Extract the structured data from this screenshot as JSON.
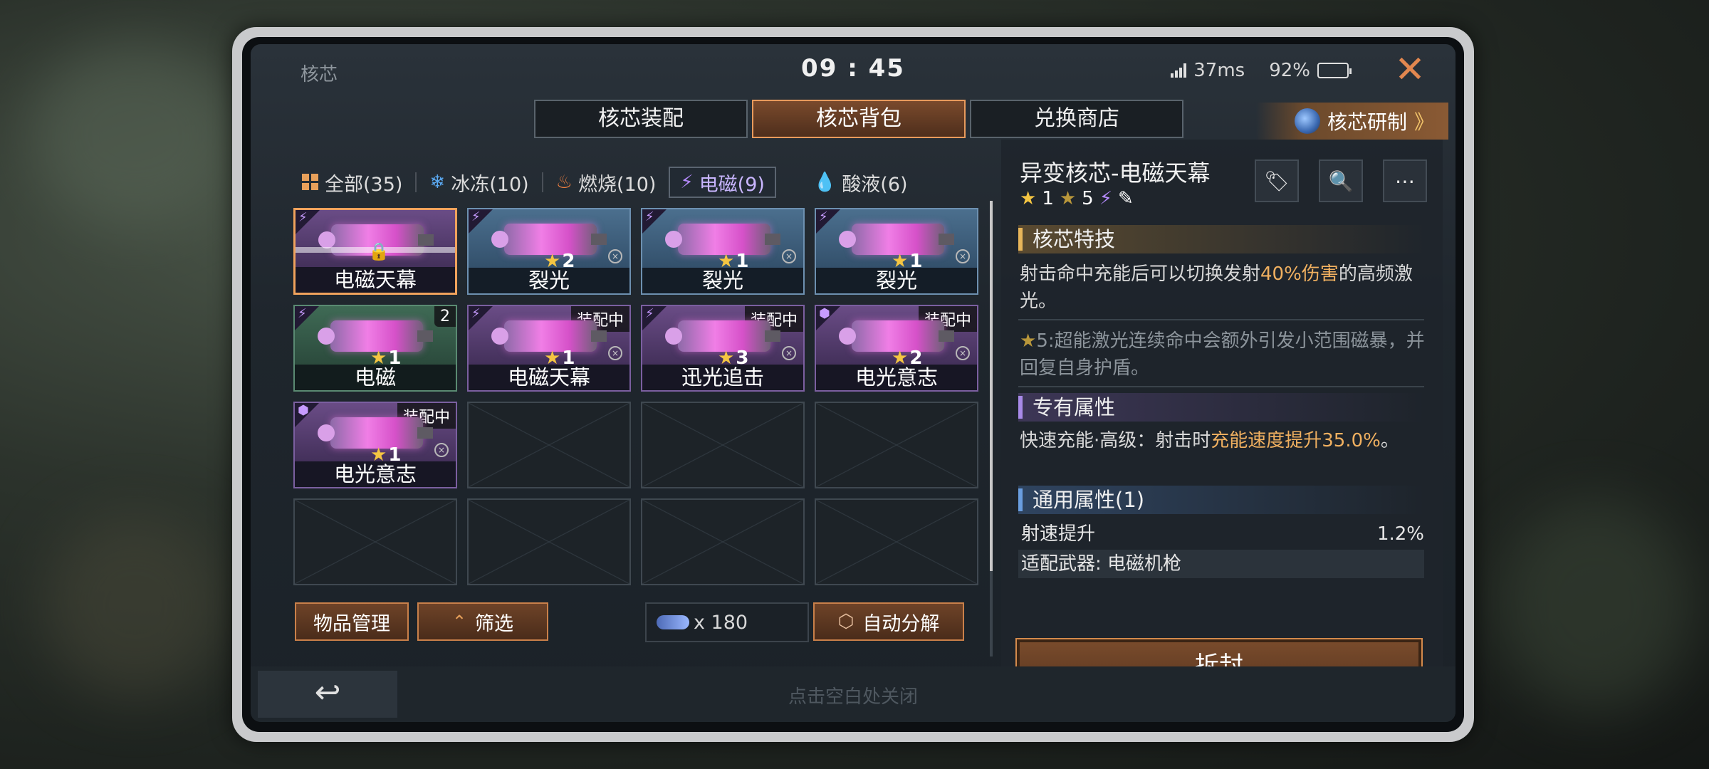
{
  "window": {
    "title": "核芯",
    "clock": "09 : 45",
    "ping": "37ms",
    "battery": "92%",
    "battery_level": 0.92
  },
  "tabs": [
    {
      "label": "核芯装配",
      "active": false
    },
    {
      "label": "核芯背包",
      "active": true
    },
    {
      "label": "兑换商店",
      "active": false
    }
  ],
  "research": {
    "label": "核芯研制",
    "chevron": "》"
  },
  "filters": [
    {
      "label": "全部(35)",
      "icon": "grid-icon",
      "color": "#e8a05a"
    },
    {
      "label": "冰冻(10)",
      "icon": "snowflake-icon",
      "color": "#5aa8f0"
    },
    {
      "label": "燃烧(10)",
      "icon": "flame-icon",
      "color": "#f08040"
    },
    {
      "label": "电磁(9)",
      "icon": "lightning-icon",
      "color": "#b58aff",
      "active": true
    },
    {
      "label": "酸液(6)",
      "icon": "acid-drop-icon",
      "color": "#a0d040"
    }
  ],
  "cores": [
    {
      "name": "电磁天幕",
      "rarity": "purple",
      "stars": "",
      "locked": true,
      "selected": true
    },
    {
      "name": "裂光",
      "rarity": "blue",
      "stars": "2"
    },
    {
      "name": "裂光",
      "rarity": "blue",
      "stars": "1"
    },
    {
      "name": "裂光",
      "rarity": "blue",
      "stars": "1"
    },
    {
      "name": "电磁",
      "rarity": "green",
      "stars": "1",
      "count": "2"
    },
    {
      "name": "电磁天幕",
      "rarity": "purple",
      "stars": "1",
      "tag": "装配中"
    },
    {
      "name": "迅光追击",
      "rarity": "purple",
      "stars": "3",
      "tag": "装配中"
    },
    {
      "name": "电光意志",
      "rarity": "purple",
      "stars": "2",
      "tag": "装配中"
    },
    {
      "name": "电光意志",
      "rarity": "purple",
      "stars": "1",
      "tag": "装配中"
    }
  ],
  "bottom": {
    "manage_label": "物品管理",
    "filter_label": "筛选",
    "chip_count": "x 180",
    "auto_decompose_label": "自动分解"
  },
  "detail": {
    "title": "异变核芯-电磁天幕",
    "star_a": "1",
    "star_b": "5",
    "skill_head": "核芯特技",
    "skill_pre": "射击命中充能后可以切换发射",
    "skill_hl": "40%伤害",
    "skill_post": "的高频激光。",
    "star5_label": "5:",
    "star5_text": "超能激光连续命中会额外引发小范围磁暴，并回复自身护盾。",
    "exclusive_head": "专有属性",
    "exclusive_pre": "快速充能·高级：射击时",
    "exclusive_hl": "充能速度提升35.0%",
    "exclusive_post": "。",
    "general_head": "通用属性(1)",
    "attr_name": "射速提升",
    "attr_value": "1.2%",
    "weapon_label": "适配武器: 电磁机枪",
    "unseal_label": "拆封"
  },
  "footer": {
    "hint": "点击空白处关闭"
  }
}
